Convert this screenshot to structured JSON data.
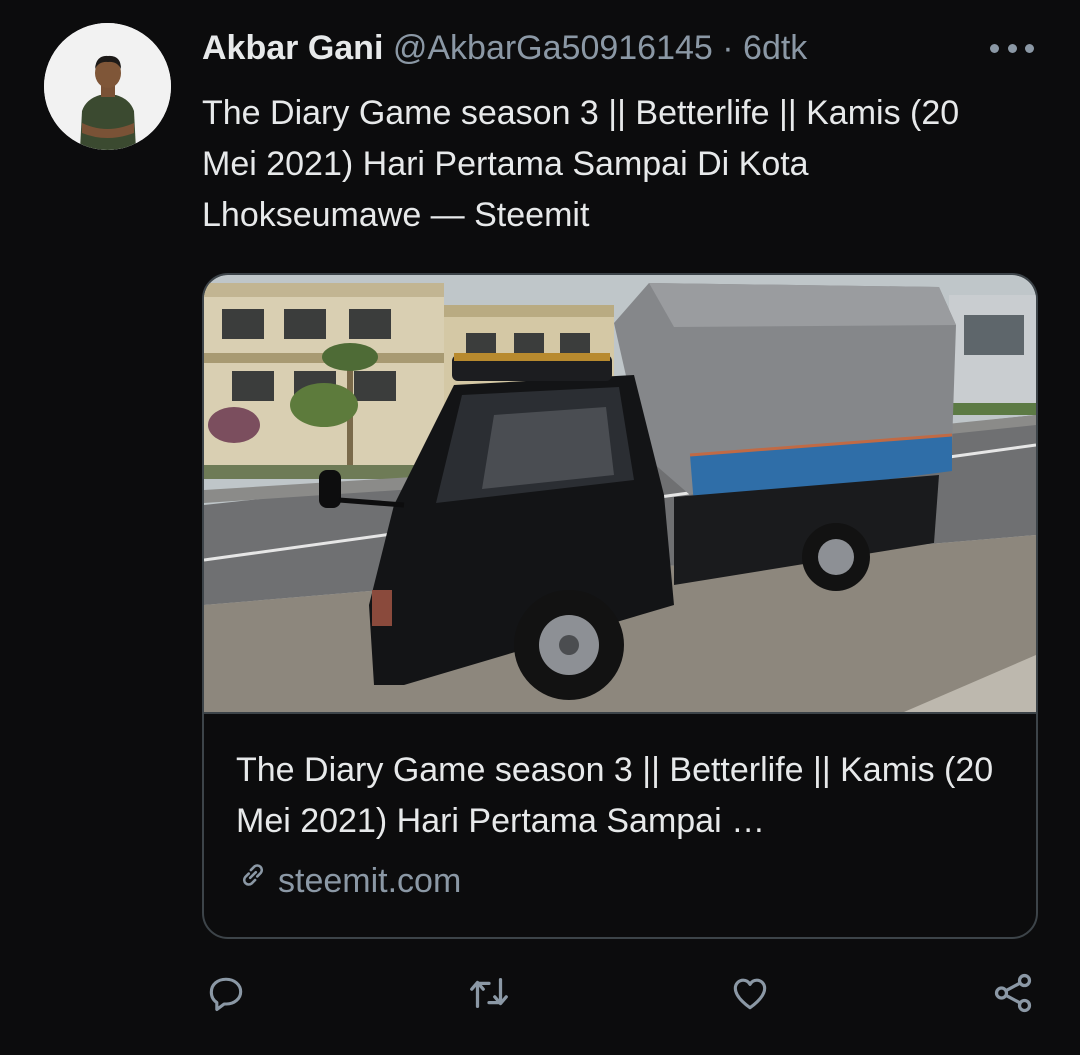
{
  "author": {
    "name": "Akbar Gani",
    "handle": "@AkbarGa50916145",
    "separator": "·",
    "time": "6dtk"
  },
  "tweet": {
    "text": "The Diary Game season 3 || Betterlife || Kamis (20 Mei 2021) Hari Pertama Sampai Di Kota Lhokseumawe — Steemit"
  },
  "link_card": {
    "title": "The Diary Game season 3 || Betterlife || Kamis (20 Mei 2021) Hari Pertama Sampai …",
    "domain": "steemit.com"
  },
  "icons": {
    "more": "more-horizontal-icon",
    "reply": "reply-icon",
    "retweet": "retweet-icon",
    "like": "heart-icon",
    "share": "share-icon",
    "link": "link-icon"
  },
  "colors": {
    "background": "#0c0c0d",
    "text": "#e7e9ea",
    "muted": "#8b98a5",
    "border": "#3d4449"
  }
}
